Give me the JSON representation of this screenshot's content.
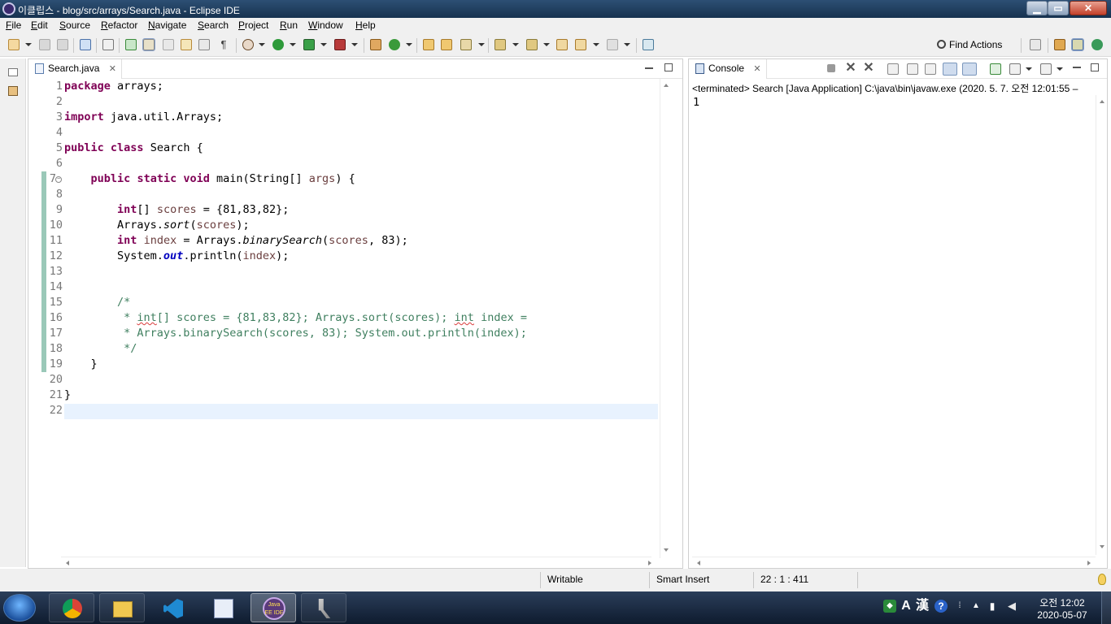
{
  "window": {
    "title": "이클립스 - blog/src/arrays/Search.java - Eclipse IDE",
    "minimize_label": "▁",
    "maximize_label": "▭",
    "close_label": "✕"
  },
  "menu": [
    "File",
    "Edit",
    "Source",
    "Refactor",
    "Navigate",
    "Search",
    "Project",
    "Run",
    "Window",
    "Help"
  ],
  "toolbar": {
    "find_actions_label": "Find Actions"
  },
  "editor": {
    "tab_label": "Search.java",
    "tab_close": "✕",
    "line_numbers": [
      "1",
      "2",
      "3",
      "4",
      "5",
      "6",
      "7",
      "8",
      "9",
      "10",
      "11",
      "12",
      "13",
      "14",
      "15",
      "16",
      "17",
      "18",
      "19",
      "20",
      "21",
      "22"
    ]
  },
  "console": {
    "tab_label": "Console",
    "tab_close": "✕",
    "header": "<terminated> Search [Java Application] C:\\java\\bin\\javaw.exe  (2020. 5. 7. 오전 12:01:55 – ",
    "output": "1"
  },
  "status": {
    "writable": "Writable",
    "insert_mode": "Smart Insert",
    "position": "22 : 1 : 411"
  },
  "taskbar": {
    "time": "오전 12:02",
    "date": "2020-05-07",
    "ime_lang": "A",
    "ime_hanja": "漢",
    "apps": [
      "chrome-icon",
      "explorer-icon",
      "vscode-icon",
      "media-icon",
      "eclipse-icon",
      "tools-icon"
    ],
    "active_app_label": "Java EE IDE"
  },
  "colors": {
    "keyword": "#7f0055",
    "comment": "#3f7f5f",
    "field": "#0000c0",
    "variable": "#6a3e3e",
    "current_line": "#e8f2fe",
    "diff_bar": "#9ac8b8"
  }
}
